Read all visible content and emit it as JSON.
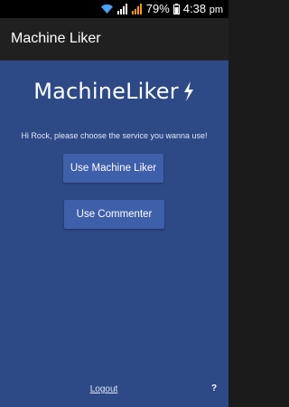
{
  "status_bar": {
    "battery_percent": "79%",
    "time": "4:38",
    "time_suffix": "pm"
  },
  "action_bar": {
    "title": "Machine Liker"
  },
  "main": {
    "logo_text": "MachineLiker",
    "greeting": "Hi Rock, please choose the service you wanna use!",
    "use_liker_label": "Use Machine Liker",
    "use_commenter_label": "Use Commenter",
    "logout_label": "Logout",
    "help_label": "?"
  },
  "colors": {
    "background": "#2d4a87",
    "button": "#3e5fa9",
    "action_bar": "#202020",
    "status_bar": "#000000"
  }
}
